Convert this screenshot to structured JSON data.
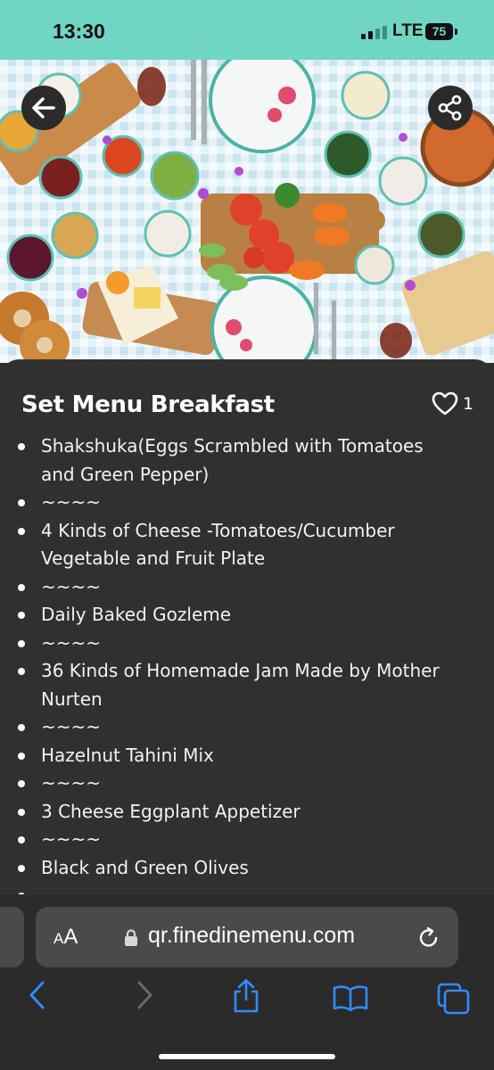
{
  "status_bar": {
    "time": "13:30",
    "network": "LTE",
    "battery": "75"
  },
  "hero": {
    "image_alt_icon": "breakfast-spread-photo"
  },
  "card": {
    "title": "Set Menu Breakfast",
    "likes": "1",
    "items": [
      " Shakshuka(Eggs Scrambled with Tomatoes and Green Pepper)",
      "~~~~",
      "4 Kinds of Cheese -Tomatoes/Cucumber Vegetable and Fruit Plate",
      "~~~~",
      "Daily Baked Gozleme",
      "~~~~",
      "36 Kinds of Homemade Jam Made by Mother Nurten",
      "~~~~",
      "Hazelnut Tahini Mix",
      "~~~~",
      "3 Cheese Eggplant Appetizer",
      "~~~~",
      "Black and Green Olives",
      "~~~~"
    ]
  },
  "browser": {
    "aa_small": "A",
    "aa_big": "A",
    "url": "qr.finedinemenu.com"
  },
  "colors": {
    "accent": "#6fd6c3",
    "ios_blue": "#2f8cff",
    "card_bg": "#303030"
  }
}
